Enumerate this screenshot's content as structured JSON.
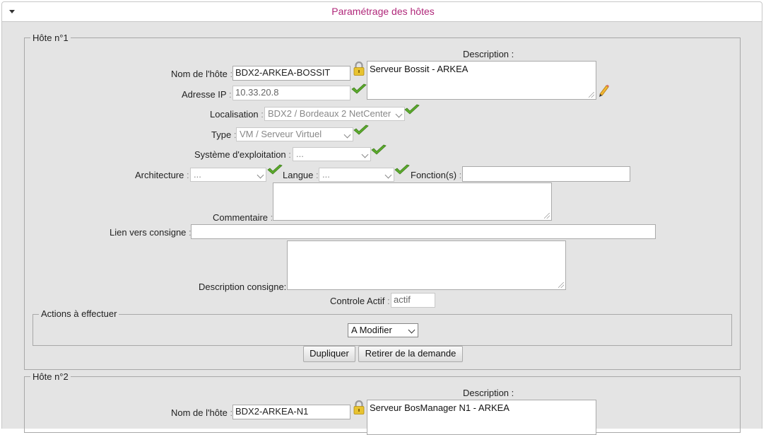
{
  "panel": {
    "title": "Paramétrage des hôtes"
  },
  "host1": {
    "legend": "Hôte n°1",
    "description_label": "Description :",
    "description_value": "Serveur Bossit - ARKEA",
    "name_label": "Nom de l'hôte",
    "name_value": "BDX2-ARKEA-BOSSIT",
    "ip_label": "Adresse IP",
    "ip_value": "10.33.20.8",
    "location_label": "Localisation",
    "location_value": "BDX2 / Bordeaux 2 NetCenter",
    "type_label": "Type",
    "type_value": "VM / Serveur Virtuel",
    "os_label": "Système d'exploitation",
    "os_value": "...",
    "arch_label": "Architecture",
    "arch_value": "...",
    "lang_label": "Langue",
    "lang_value": "...",
    "functions_label": "Fonction(s)",
    "functions_value": "",
    "comment_label": "Commentaire",
    "comment_value": "",
    "link_label": "Lien vers consigne",
    "link_value": "",
    "desc_consigne_label": "Description consigne:",
    "desc_consigne_value": "",
    "control_label": "Controle Actif",
    "control_value": "actif",
    "actions_legend": "Actions à effectuer",
    "action_value": "A Modifier",
    "duplicate_btn": "Dupliquer",
    "remove_btn": "Retirer de la demande"
  },
  "host2": {
    "legend": "Hôte n°2",
    "description_label": "Description :",
    "description_value": "Serveur BosManager N1 - ARKEA",
    "name_label": "Nom de l'hôte",
    "name_value": "BDX2-ARKEA-N1"
  },
  "icons": {
    "lock": "lock-icon",
    "check": "check-icon",
    "edit": "pencil-icon",
    "caret": "caret-down-icon"
  },
  "colors": {
    "title": "#b0287a",
    "check": "#5cab2d",
    "background": "#e4e4e4"
  }
}
